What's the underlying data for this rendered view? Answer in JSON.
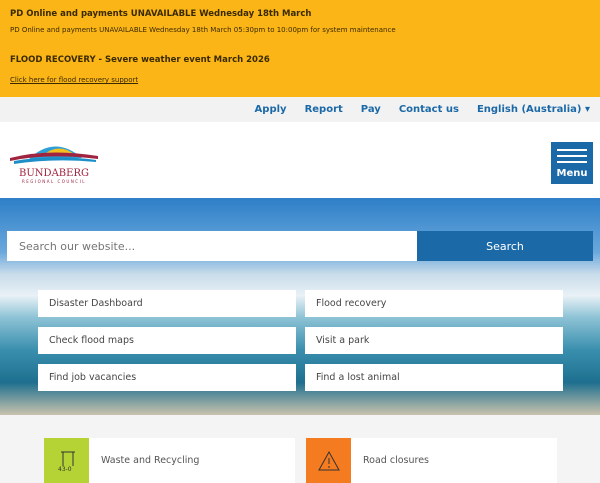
{
  "alerts": {
    "title1": "PD Online and payments UNAVAILABLE Wednesday 18th March",
    "text1": "PD Online and payments UNAVAILABLE Wednesday 18th March 05:30pm to 10:00pm for system maintenance",
    "title2": "FLOOD RECOVERY - Severe weather event March 2026",
    "link2": "Click here for flood recovery support"
  },
  "util_nav": [
    "Apply",
    "Report",
    "Pay",
    "Contact us",
    "English (Australia) ▾"
  ],
  "logo": {
    "name": "BUNDABERG",
    "sub": "REGIONAL COUNCIL"
  },
  "menu_label": "Menu",
  "search": {
    "placeholder": "Search our website...",
    "button": "Search"
  },
  "quick_links": [
    "Disaster Dashboard",
    "Flood recovery",
    "Check flood maps",
    "Visit a park",
    "Find job vacancies",
    "Find a lost animal"
  ],
  "tiles": [
    {
      "label": "Waste and Recycling",
      "color": "#b5d334"
    },
    {
      "label": "Road closures",
      "color": "#f47b20"
    }
  ]
}
